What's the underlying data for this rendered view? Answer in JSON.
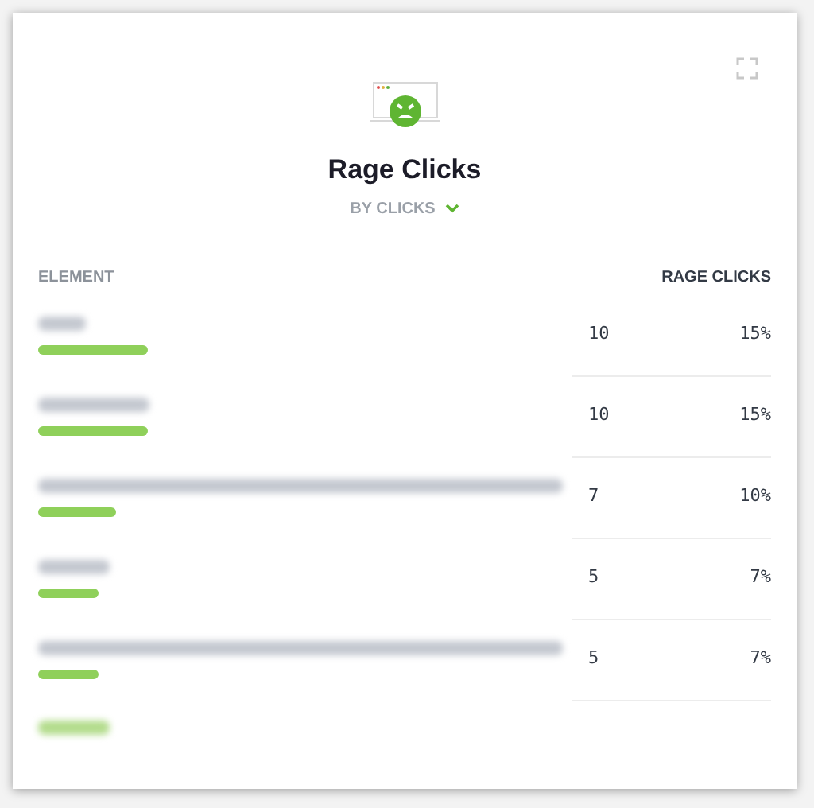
{
  "widget": {
    "title": "Rage Clicks",
    "sort_label": "BY CLICKS"
  },
  "table": {
    "columns": [
      "ELEMENT",
      "RAGE CLICKS"
    ],
    "rows": [
      {
        "count": "10",
        "percent": "15%"
      },
      {
        "count": "10",
        "percent": "15%"
      },
      {
        "count": "7",
        "percent": "10%"
      },
      {
        "count": "5",
        "percent": "7%"
      },
      {
        "count": "5",
        "percent": "7%"
      }
    ]
  }
}
